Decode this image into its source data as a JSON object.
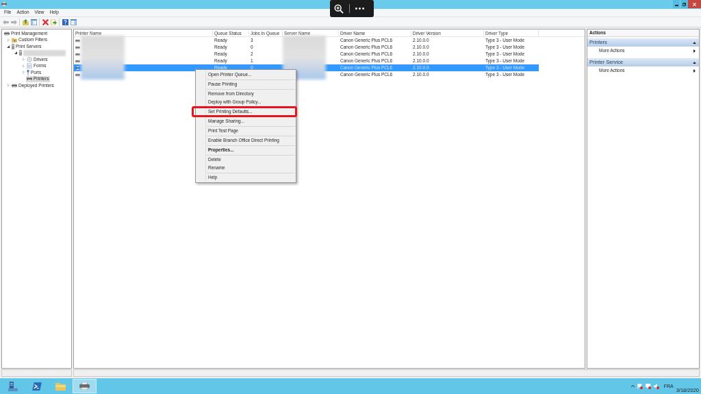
{
  "menu_bar": [
    "File",
    "Action",
    "View",
    "Help"
  ],
  "toolbar": [
    [
      {
        "kind": "back",
        "disabled": true
      },
      {
        "kind": "forward",
        "disabled": true
      }
    ],
    [
      {
        "kind": "up",
        "disabled": false
      },
      {
        "kind": "tree",
        "disabled": false
      }
    ],
    [
      {
        "kind": "delete",
        "disabled": false
      },
      {
        "kind": "export",
        "disabled": false
      }
    ],
    [
      {
        "kind": "help",
        "disabled": false
      },
      {
        "kind": "pane",
        "disabled": false
      }
    ]
  ],
  "tree": [
    {
      "label": "Print Management",
      "kind": "root",
      "selected": false,
      "children": [
        {
          "label": "Custom Filters",
          "kind": "filters",
          "expanded": false,
          "selected": false
        },
        {
          "label": "Print Servers",
          "kind": "servers",
          "expanded": true,
          "selected": false,
          "children": [
            {
              "kind": "server",
              "redacted": true,
              "expanded": true,
              "selected": false,
              "children": [
                {
                  "label": "Drivers",
                  "kind": "drivers",
                  "expanded": false,
                  "selected": false
                },
                {
                  "label": "Forms",
                  "kind": "forms",
                  "expanded": false,
                  "selected": false
                },
                {
                  "label": "Ports",
                  "kind": "ports",
                  "expanded": false,
                  "selected": false
                },
                {
                  "label": "Printers",
                  "kind": "printers",
                  "selected": true
                }
              ]
            }
          ]
        },
        {
          "label": "Deployed Printers",
          "kind": "deployed",
          "expanded": false,
          "selected": false
        }
      ]
    }
  ],
  "table": {
    "columns": [
      {
        "label": "Printer Name",
        "redacted": true
      },
      {
        "label": "Queue Status"
      },
      {
        "label": "Jobs In Queue"
      },
      {
        "label": "Server Name",
        "redacted": true
      },
      {
        "label": "Driver Name"
      },
      {
        "label": "Driver Version"
      },
      {
        "label": "Driver Type"
      }
    ],
    "rows": [
      {
        "queue_status": "Ready",
        "jobs": "3",
        "driver_name": "Canon Generic Plus PCL6",
        "driver_version": "2.10.0.0",
        "driver_type": "Type 3 - User Mode",
        "selected": false
      },
      {
        "queue_status": "Ready",
        "jobs": "0",
        "driver_name": "Canon Generic Plus PCL6",
        "driver_version": "2.10.0.0",
        "driver_type": "Type 3 - User Mode",
        "selected": false
      },
      {
        "queue_status": "Ready",
        "jobs": "2",
        "driver_name": "Canon Generic Plus PCL6",
        "driver_version": "2.10.0.0",
        "driver_type": "Type 3 - User Mode",
        "selected": false
      },
      {
        "queue_status": "Ready",
        "jobs": "1",
        "driver_name": "Canon Generic Plus PCL6",
        "driver_version": "2.10.0.0",
        "driver_type": "Type 3 - User Mode",
        "selected": false
      },
      {
        "queue_status": "Ready",
        "jobs": "0",
        "driver_name": "Canon Generic Plus PCL6",
        "driver_version": "2.10.0.0",
        "driver_type": "Type 3 - User Mode",
        "selected": true
      },
      {
        "driver_name": "Canon Generic Plus PCL6",
        "driver_version": "2.10.0.0",
        "driver_type": "Type 3 - User Mode",
        "selected": false
      }
    ]
  },
  "context_menu": {
    "groups": [
      [
        {
          "label": "Open Printer Queue...",
          "default": false,
          "annotated": false
        }
      ],
      [
        {
          "label": "Pause Printing",
          "default": false,
          "annotated": false
        }
      ],
      [
        {
          "label": "Remove from Directory",
          "default": false,
          "annotated": false
        },
        {
          "label": "Deploy with Group Policy...",
          "default": false,
          "annotated": false
        }
      ],
      [
        {
          "label": "Set Printing Defaults...",
          "default": false,
          "annotated": true
        }
      ],
      [
        {
          "label": "Manage Sharing...",
          "default": false,
          "annotated": false
        }
      ],
      [
        {
          "label": "Print Test Page",
          "default": false,
          "annotated": false
        }
      ],
      [
        {
          "label": "Enable Branch Office Direct Printing",
          "default": false,
          "annotated": false
        }
      ],
      [
        {
          "label": "Properties...",
          "default": true,
          "annotated": false
        }
      ],
      [
        {
          "label": "Delete",
          "default": false,
          "annotated": false
        },
        {
          "label": "Rename",
          "default": false,
          "annotated": false
        }
      ],
      [
        {
          "label": "Help",
          "default": false,
          "annotated": false
        }
      ]
    ]
  },
  "actions": {
    "title": "Actions",
    "sections": [
      {
        "title": "Printers",
        "expanded": true,
        "items": [
          "More Actions"
        ]
      },
      {
        "title": "Printer Service",
        "expanded": true,
        "items": [
          "More Actions"
        ]
      }
    ]
  },
  "taskbar": {
    "apps": [
      {
        "kind": "server-manager",
        "active": false
      },
      {
        "kind": "powershell",
        "active": false
      },
      {
        "kind": "explorer",
        "active": false
      },
      {
        "kind": "print-management",
        "active": true
      }
    ],
    "tray": {
      "language": "FRA",
      "date": "3/18/2020"
    }
  }
}
